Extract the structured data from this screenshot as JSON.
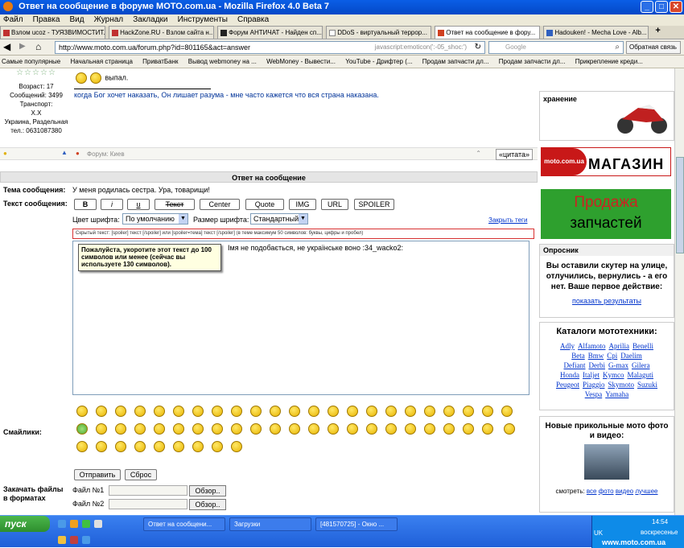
{
  "window": {
    "title": "Ответ на сообщение в форуме MOTO.com.ua - Mozilla Firefox 4.0 Beta 7",
    "controls": {
      "minimize": "_",
      "maximize": "□",
      "close": "✕"
    }
  },
  "menu": [
    "Файл",
    "Правка",
    "Вид",
    "Журнал",
    "Закладки",
    "Инструменты",
    "Справка"
  ],
  "tabs": [
    {
      "label": "Взлом ucoz - ТУЯЗВИМОСТИТ...",
      "active": false
    },
    {
      "label": "HackZone.RU - Взлом сайта н...",
      "active": false
    },
    {
      "label": "Форум АНТИЧАТ - Найден сп...",
      "active": false
    },
    {
      "label": "DDoS - виртуальный террор...",
      "active": false
    },
    {
      "label": "Ответ на сообщение в фору...",
      "active": true
    },
    {
      "label": "Hadouken! - Mecha Love - Alb...",
      "active": false
    }
  ],
  "navbar": {
    "url": "http://www.moto.com.ua/forum.php?id=801165&act=answer",
    "js_hint": "javascript:emoticon(':-05_shoc:')",
    "search_placeholder": "Google",
    "feedback": "Обратная связь"
  },
  "bookmarks": [
    "Самые популярные",
    "Начальная страница",
    "ПриватБанк",
    "Вывод webmoney на ...",
    "WebMoney - Вывести...",
    "YouTube - Дрифтер (...",
    "Продам запчасти дл...",
    "Продам запчасти дл...",
    "Прикрепление креди..."
  ],
  "post": {
    "age": "Возраст: 17",
    "messages": "Сообщений: 3499",
    "transport": "Транспорт:",
    "transport_value": "Х.Х",
    "location": "Украина, Раздельная",
    "phone": "тел.: 0631087380",
    "top_text": "выпал.",
    "signature": "когда Бог хочет наказать, Он лишает разума - мне часто кажется что вся страна наказана.",
    "forum": "Форум: Киев",
    "quote_btn": "«цитата»"
  },
  "reply": {
    "header": "Ответ на сообщение",
    "subject_label": "Тема сообщения:",
    "subject_value": "У меня родилась сестра. Ура, товарищи!",
    "text_label": "Текст сообщения:",
    "format_buttons": [
      "B",
      "i",
      "u",
      "Текст",
      "Center",
      "Quote",
      "IMG",
      "URL",
      "SPOILER"
    ],
    "font_color_label": "Цвет шрифта:",
    "font_color_value": "По умолчанию",
    "font_size_label": "Размер шрифта:",
    "font_size_value": "Стандартный",
    "close_tags": "Закрыть теги",
    "spoiler_hint": "Скрытый текст: [spoiler] текст [/spoiler] или [spoiler=тема] текст [/spoiler] (в теме максимум 50 символов: буквы, цифры и пробел)",
    "textarea_text": "Iмя не подобається, не українське воно  :34_wacko2:",
    "tooltip": "Пожалуйста, укоротите этот текст до 100 символов или менее (сейчас вы используете 130 символов).",
    "smilies_label": "Смайлики:",
    "submit": "Отправить",
    "reset": "Сброс",
    "attach_label": "Закачать файлы в форматах",
    "file1": "Файл №1",
    "file2": "Файл №2",
    "browse": "Обзор.."
  },
  "sidebar": {
    "storage_title": "хранение",
    "shop_label": "МАГАЗИН",
    "shop_logo": "moto.com.ua",
    "sale_line1": "Продажа",
    "sale_line2": "запчастей",
    "poll_head": "Опросник",
    "poll_question": "Вы оставили скутер на улице, отлучились, вернулись - а его нет. Ваше первое действие:",
    "poll_results": "показать результаты",
    "catalog_title": "Каталоги мототехники:",
    "brands": [
      "Adly",
      "Alfamoto",
      "Aprilia",
      "Benelli",
      "Beta",
      "Bmw",
      "Cpi",
      "Daelim",
      "Defiant",
      "Derbi",
      "G-max",
      "Gilera",
      "Honda",
      "Italjet",
      "Kymco",
      "Malaguti",
      "Peugeot",
      "Piaggio",
      "Skymoto",
      "Suzuki",
      "Vespa",
      "Yamaha"
    ],
    "photos_title": "Новые прикольные мото фото и видео:",
    "watch_label": "смотреть:",
    "watch_links": [
      "все",
      "фото",
      "видео",
      "лучшее"
    ]
  },
  "taskbar": {
    "start": "пуск",
    "tasks": [
      "Ответ на сообщени...",
      "Загрузки",
      "[481570725] - Окно ..."
    ],
    "lang": "UK",
    "time": "14:54",
    "day": "воскресенье",
    "watermark": "www.moto.com.ua"
  },
  "colors": {
    "link": "#0033cc",
    "sale_bg": "#2ea02e",
    "sale_text": "#cc2222",
    "shop_bg": "#c81818",
    "title_bar": "#0a5ee6"
  }
}
